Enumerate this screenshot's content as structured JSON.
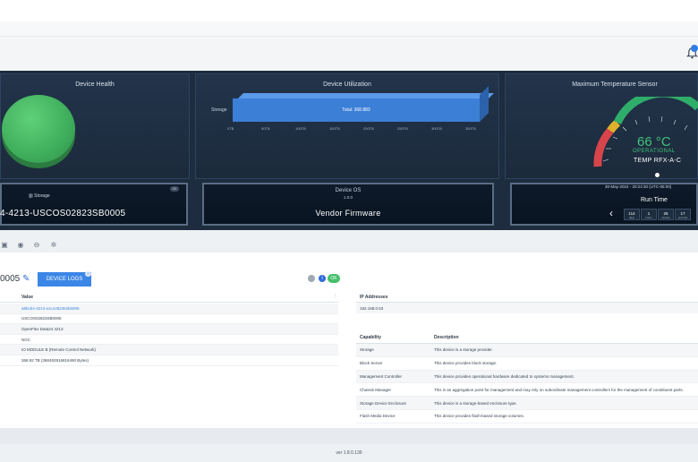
{
  "panels": {
    "health_title": "Device Health",
    "utilization_title": "Device Utilization",
    "temperature_title": "Maximum Temperature Sensor"
  },
  "utilization": {
    "row_label": "Storage",
    "bar_label": "Total: 368.883",
    "bar_value_fraction": 1.0,
    "x_ticks": [
      "0TB",
      "50TB",
      "100TB",
      "150TB",
      "200TB",
      "250TB",
      "300TB",
      "350TB"
    ],
    "bar_color": "#3c7fd6"
  },
  "health": {
    "color": "#3fae5c",
    "fraction": 1.0
  },
  "temperature": {
    "value": "66 °C",
    "status": "OPERATIONAL",
    "sensor": "TEMP RFX-A-C",
    "status_color": "#3fc37a"
  },
  "cards": {
    "storage_title": "Storage",
    "storage_tag": "OK",
    "serial": "4-4213-USCOS02823SB0005",
    "os_title": "Device OS",
    "os_version": "1.0.0",
    "os_name": "Vendor Firmware",
    "run_date": "30-May-2024 - 20:24:30 (UTC-05:00)",
    "run_title": "Run Time",
    "run_time": [
      {
        "value": "114",
        "unit": "days"
      },
      {
        "value": "1",
        "unit": "hours"
      },
      {
        "value": "26",
        "unit": "minutes"
      },
      {
        "value": "17",
        "unit": "seconds"
      }
    ]
  },
  "device": {
    "id_suffix": "0005",
    "logs_button": "DEVICE LOGS",
    "logs_badge": "0",
    "status_info": "i",
    "status_ok": "OK"
  },
  "kv_table": {
    "header": "Value",
    "rows": [
      "a8bcb4-4213-usco28236sb0005",
      "USCOS02823SB0005",
      "OpenFlex Data24 4213",
      "NGC",
      "IO MODULE B (Remote Control Network)",
      "368.92 TB (368492816816490 Bytes)"
    ]
  },
  "ip": {
    "header": "IP Addresses",
    "value": "192.168.0.53"
  },
  "capabilities": {
    "headers": [
      "Capability",
      "Description"
    ],
    "rows": [
      [
        "Storage",
        "This device is a storage provider."
      ],
      [
        "Block Server",
        "This device provides block storage."
      ],
      [
        "Management Controller",
        "This device provides operational hardware dedicated to systems management."
      ],
      [
        "Chassis Manager",
        "This is an aggregation point for management and may rely on subordinate management controllers for the management of constituent parts."
      ],
      [
        "Storage Device Enclosure",
        "This device is a storage-based enclosure type."
      ],
      [
        "Flash Media Device",
        "This device provides flash-based storage volumes."
      ]
    ]
  },
  "footer": {
    "version": "ver 1.8.0.136"
  }
}
